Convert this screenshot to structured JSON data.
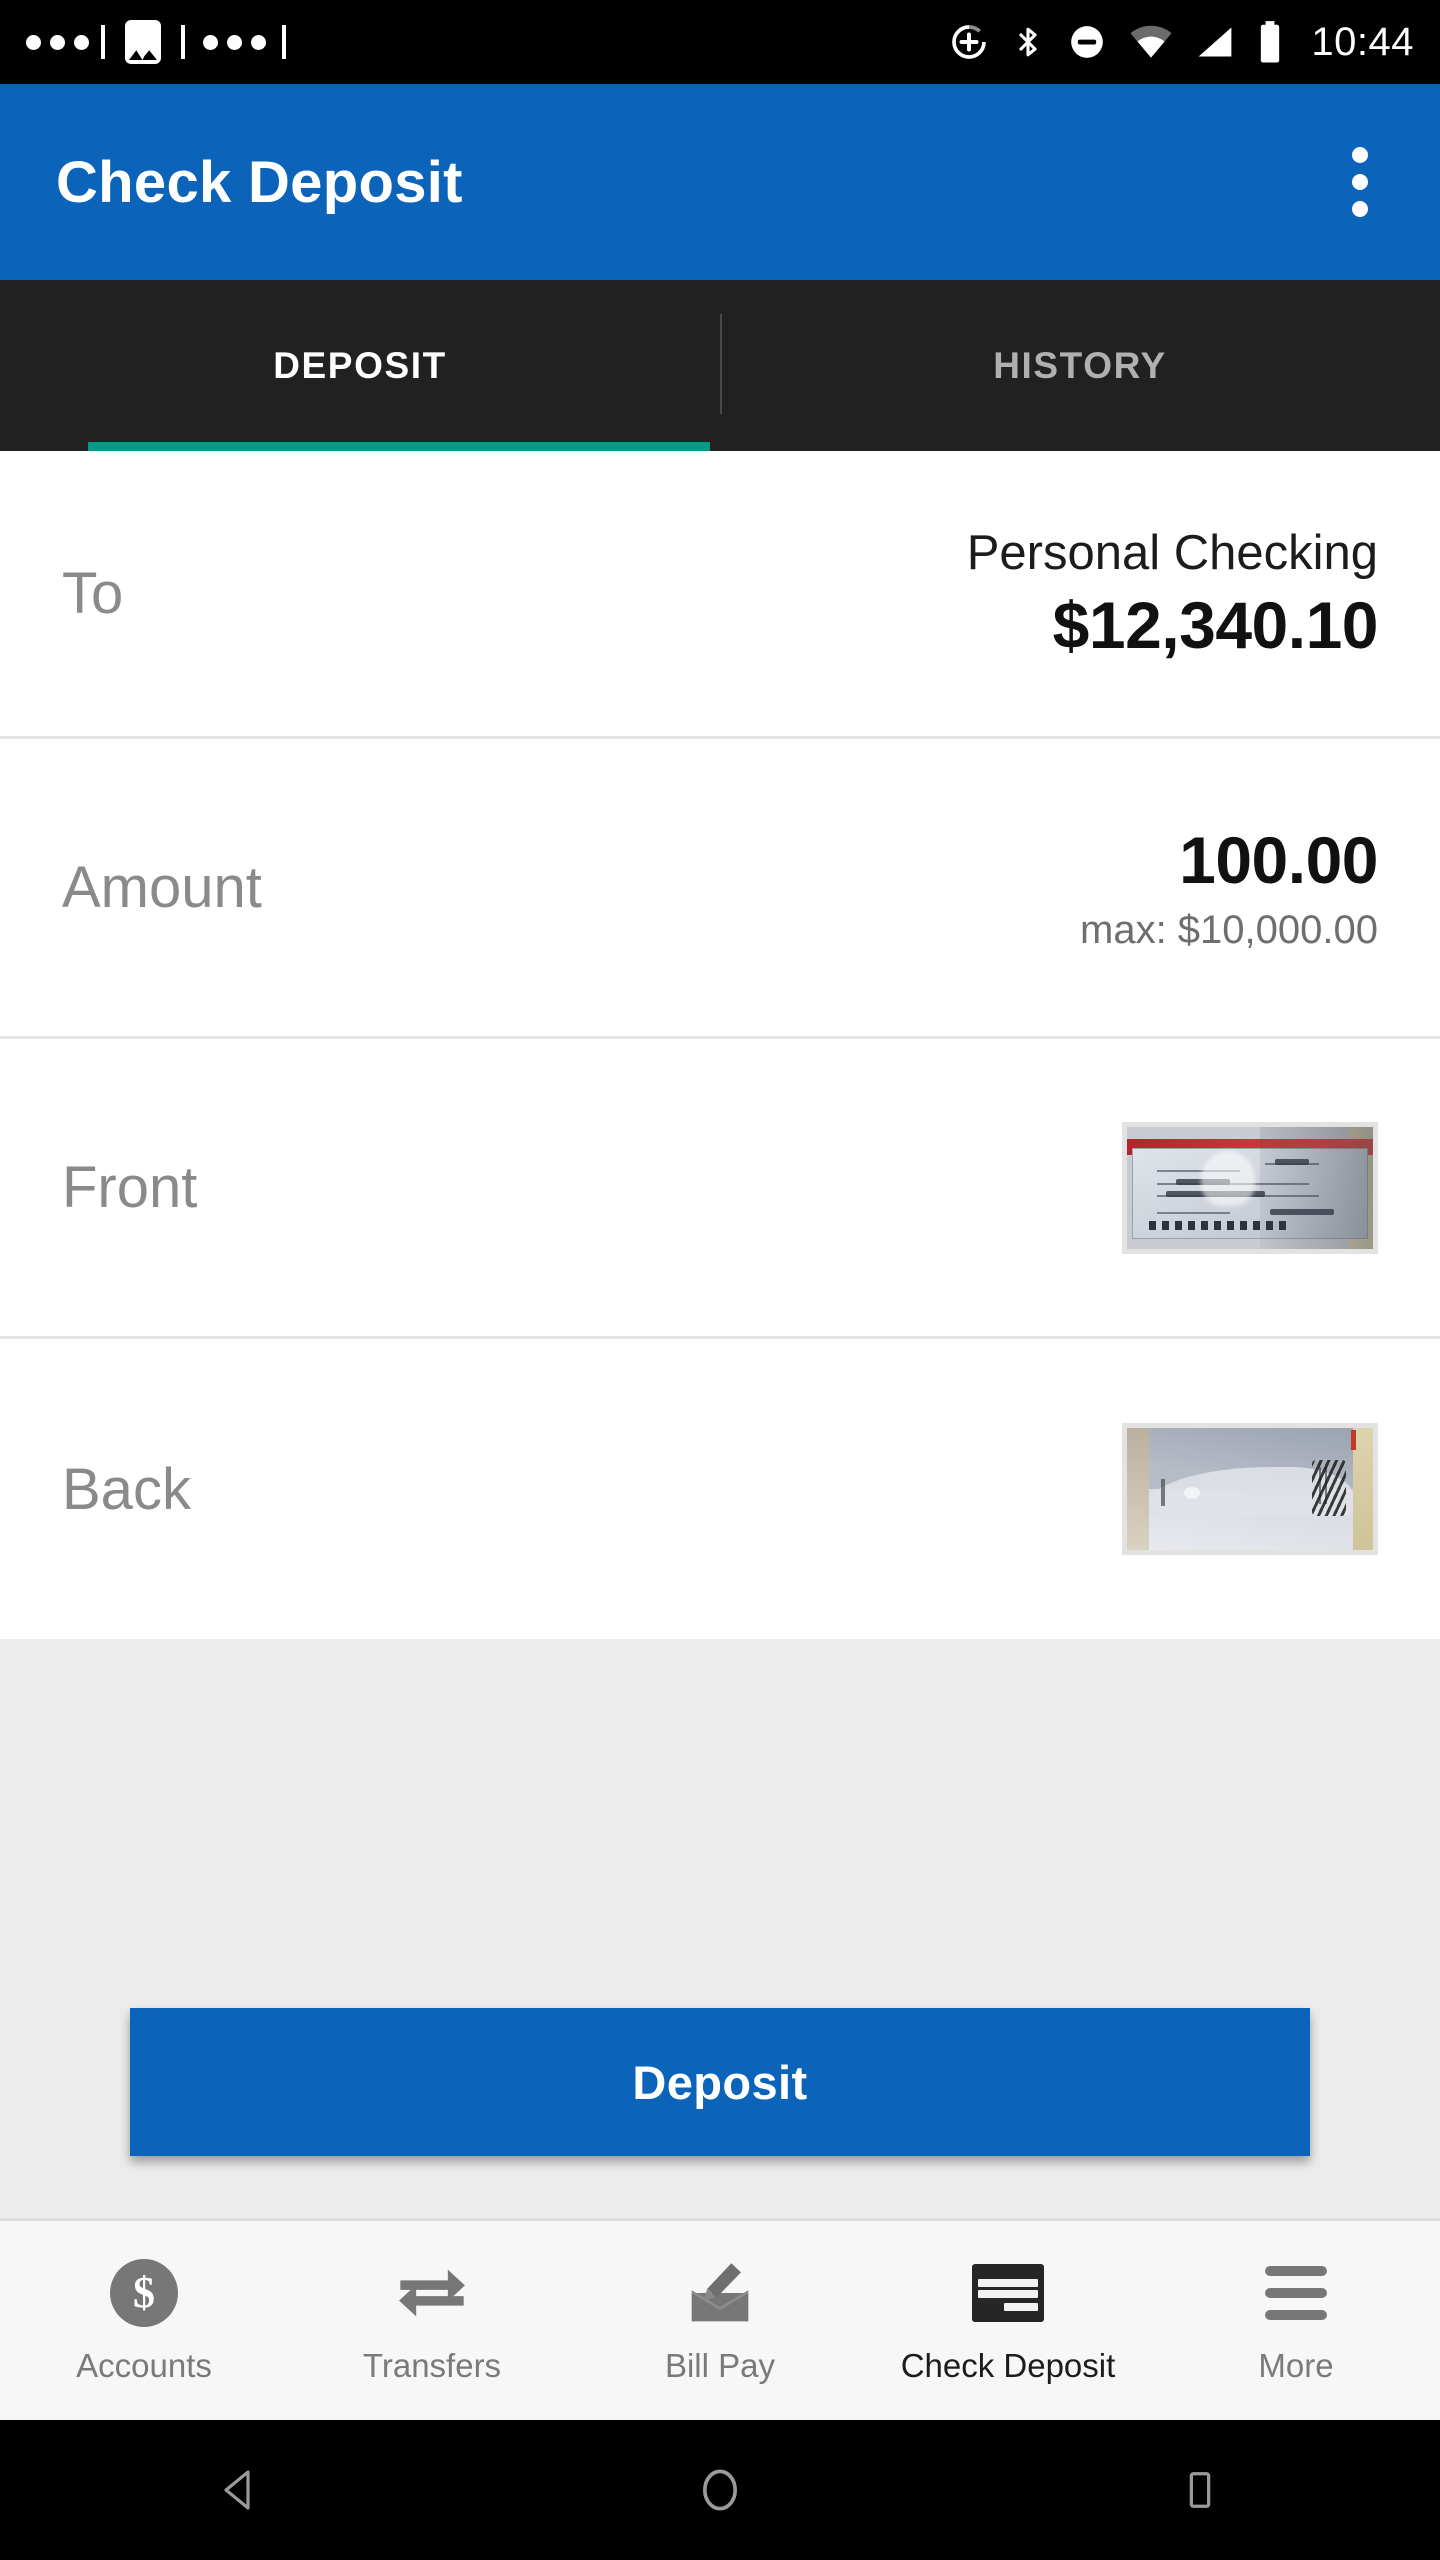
{
  "status_bar": {
    "time": "10:44",
    "left_icons": [
      "more-dots-icon",
      "divider",
      "photo-icon",
      "more-dots-icon"
    ],
    "right_icons": [
      "sync-add-icon",
      "bluetooth-icon",
      "do-not-disturb-icon",
      "wifi-icon",
      "cell-signal-icon",
      "battery-icon"
    ]
  },
  "app_bar": {
    "title": "Check Deposit",
    "overflow_icon": "more-vertical-icon",
    "background": "#0b63ba"
  },
  "tabs": {
    "indicator_color": "#009b87",
    "items": [
      {
        "label": "DEPOSIT",
        "active": true
      },
      {
        "label": "HISTORY",
        "active": false
      }
    ]
  },
  "form": {
    "to": {
      "label": "To",
      "account_name": "Personal Checking",
      "balance": "$12,340.10"
    },
    "amount": {
      "label": "Amount",
      "value": "100.00",
      "max_hint": "max: $10,000.00"
    },
    "front": {
      "label": "Front",
      "image_alt": "check-front-photo"
    },
    "back": {
      "label": "Back",
      "image_alt": "check-back-photo"
    }
  },
  "cta": {
    "deposit_label": "Deposit"
  },
  "bottom_nav": {
    "items": [
      {
        "label": "Accounts",
        "icon": "dollar-circle-icon",
        "active": false
      },
      {
        "label": "Transfers",
        "icon": "transfer-arrows-icon",
        "active": false
      },
      {
        "label": "Bill Pay",
        "icon": "envelope-pen-icon",
        "active": false
      },
      {
        "label": "Check Deposit",
        "icon": "check-icon",
        "active": true
      },
      {
        "label": "More",
        "icon": "hamburger-icon",
        "active": false
      }
    ]
  },
  "system_nav": {
    "back": "back-triangle-icon",
    "home": "home-circle-icon",
    "recents": "recents-square-icon"
  }
}
